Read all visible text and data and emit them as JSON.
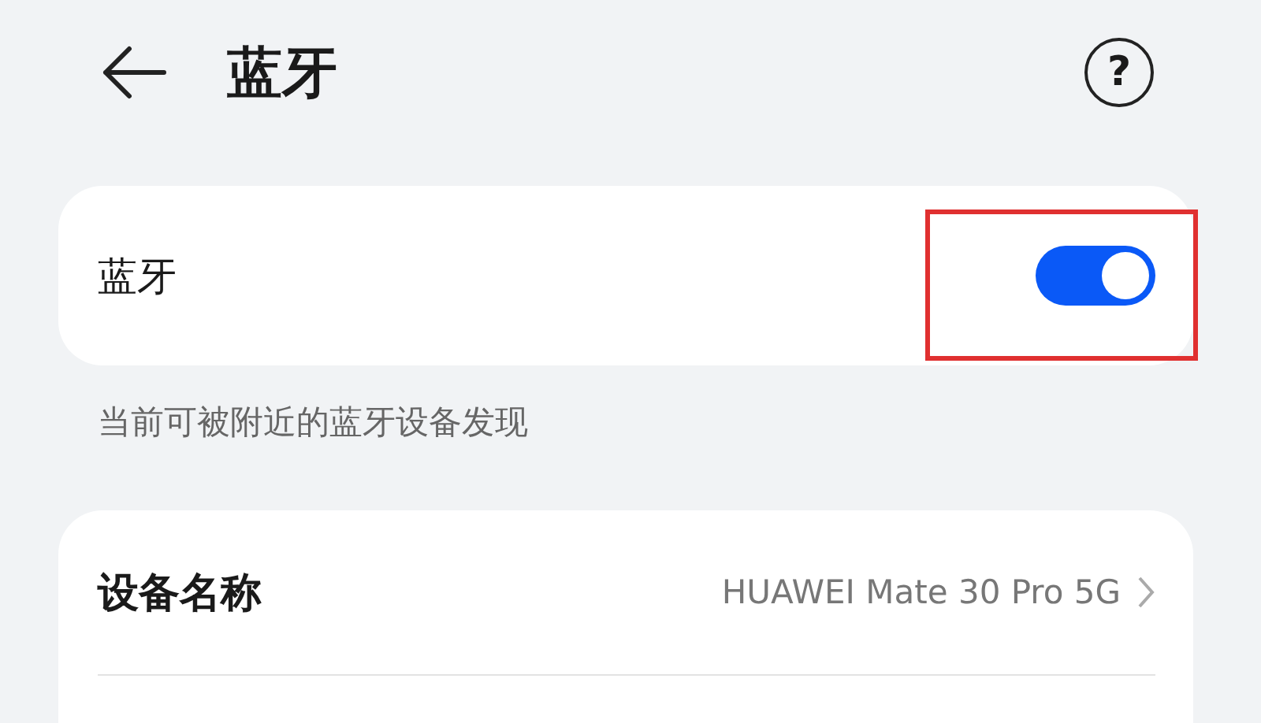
{
  "header": {
    "title": "蓝牙",
    "help_icon": "?"
  },
  "bluetooth": {
    "label": "蓝牙",
    "on": true,
    "highlighted": true
  },
  "caption": "当前可被附近的蓝牙设备发现",
  "settings": [
    {
      "label": "设备名称",
      "value": "HUAWEI Mate 30 Pro 5G"
    }
  ]
}
